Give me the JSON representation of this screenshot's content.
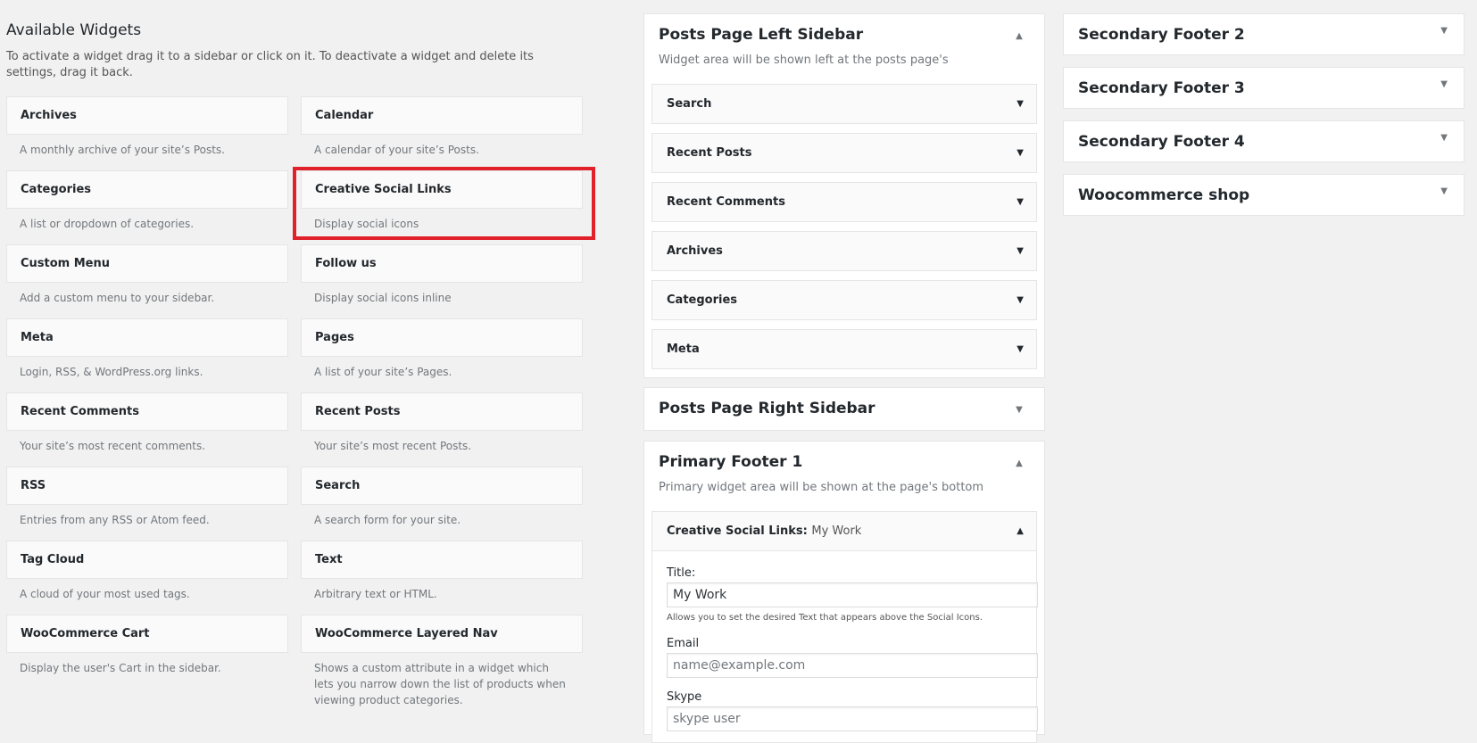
{
  "available": {
    "title": "Available Widgets",
    "description": "To activate a widget drag it to a sidebar or click on it. To deactivate a widget and delete its settings, drag it back.",
    "widgets": [
      {
        "name": "Archives",
        "desc": "A monthly archive of your site’s Posts."
      },
      {
        "name": "Calendar",
        "desc": "A calendar of your site’s Posts."
      },
      {
        "name": "Categories",
        "desc": "A list or dropdown of categories."
      },
      {
        "name": "Creative Social Links",
        "desc": "Display social icons"
      },
      {
        "name": "Custom Menu",
        "desc": "Add a custom menu to your sidebar."
      },
      {
        "name": "Follow us",
        "desc": "Display social icons inline"
      },
      {
        "name": "Meta",
        "desc": "Login, RSS, & WordPress.org links."
      },
      {
        "name": "Pages",
        "desc": "A list of your site’s Pages."
      },
      {
        "name": "Recent Comments",
        "desc": "Your site’s most recent comments."
      },
      {
        "name": "Recent Posts",
        "desc": "Your site’s most recent Posts."
      },
      {
        "name": "RSS",
        "desc": "Entries from any RSS or Atom feed."
      },
      {
        "name": "Search",
        "desc": "A search form for your site."
      },
      {
        "name": "Tag Cloud",
        "desc": "A cloud of your most used tags."
      },
      {
        "name": "Text",
        "desc": "Arbitrary text or HTML."
      },
      {
        "name": "WooCommerce Cart",
        "desc": "Display the user's Cart in the sidebar."
      },
      {
        "name": "WooCommerce Layered Nav",
        "desc": "Shows a custom attribute in a widget which lets you narrow down the list of products when viewing product categories."
      }
    ]
  },
  "left_sidebar": {
    "title": "Posts Page Left Sidebar",
    "description": "Widget area will be shown left at the posts page's",
    "toggle_icon": "arrow-up-icon",
    "widgets": [
      "Search",
      "Recent Posts",
      "Recent Comments",
      "Archives",
      "Categories",
      "Meta"
    ]
  },
  "right_sidebar": {
    "title": "Posts Page Right Sidebar",
    "toggle_icon": "arrow-down-icon"
  },
  "primary_footer_1": {
    "title": "Primary Footer 1",
    "description": "Primary widget area will be shown at the page's bottom",
    "toggle_icon": "arrow-up-icon",
    "open_widget": {
      "name": "Creative Social Links:",
      "subtitle": "My Work",
      "title_label": "Title:",
      "title_value": "My Work",
      "title_help": "Allows you to set the desired Text that appears above the Social Icons.",
      "email_label": "Email",
      "email_placeholder": "name@example.com",
      "skype_label": "Skype",
      "skype_placeholder": "skype user"
    }
  },
  "secondary_areas": [
    {
      "title": "Secondary Footer 2"
    },
    {
      "title": "Secondary Footer 3"
    },
    {
      "title": "Secondary Footer 4"
    },
    {
      "title": "Woocommerce shop"
    }
  ],
  "colors": {
    "highlight": "#e0202a",
    "background": "#f1f1f1",
    "panel": "#ffffff"
  }
}
